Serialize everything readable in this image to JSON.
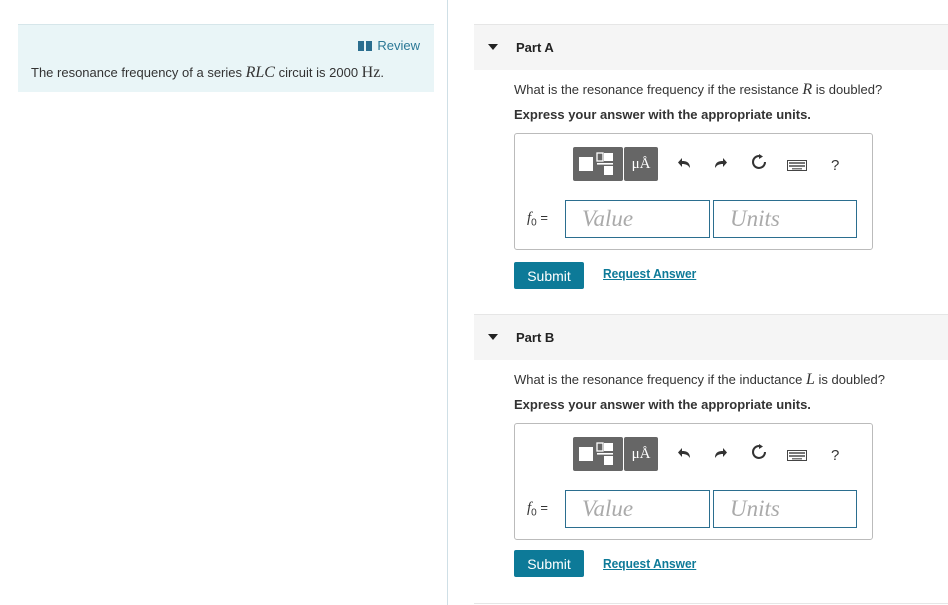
{
  "left_panel": {
    "review_label": "Review",
    "intro_before": "The resonance frequency of a series ",
    "intro_var": "RLC",
    "intro_middle": " circuit is 2000 ",
    "intro_unit": "Hz",
    "intro_after": "."
  },
  "parts": [
    {
      "title": "Part A",
      "question_before": "What is the resonance frequency if the resistance ",
      "question_var": "R",
      "question_after": " is doubled?",
      "instruction": "Express your answer with the appropriate units.",
      "label_var": "f",
      "label_sub": "0",
      "label_eq": " =",
      "value_placeholder": "Value",
      "units_placeholder": "Units",
      "submit_label": "Submit",
      "request_label": "Request Answer"
    },
    {
      "title": "Part B",
      "question_before": "What is the resonance frequency if the inductance ",
      "question_var": "L",
      "question_after": " is doubled?",
      "instruction": "Express your answer with the appropriate units.",
      "label_var": "f",
      "label_sub": "0",
      "label_eq": " =",
      "value_placeholder": "Value",
      "units_placeholder": "Units",
      "submit_label": "Submit",
      "request_label": "Request Answer"
    }
  ],
  "toolbar": {
    "mu_angstrom_label": "μÅ",
    "help_label": "?",
    "icons": [
      "templates-icon",
      "mu-angstrom-icon",
      "undo-icon",
      "redo-icon",
      "reset-icon",
      "keyboard-icon",
      "help-icon"
    ]
  },
  "colors": {
    "accent": "#0d7a98",
    "panel_bg": "#e9f5f7",
    "header_bg": "#f5f5f5",
    "toolbar_btn": "#666666",
    "input_border": "#2b6e8f"
  }
}
